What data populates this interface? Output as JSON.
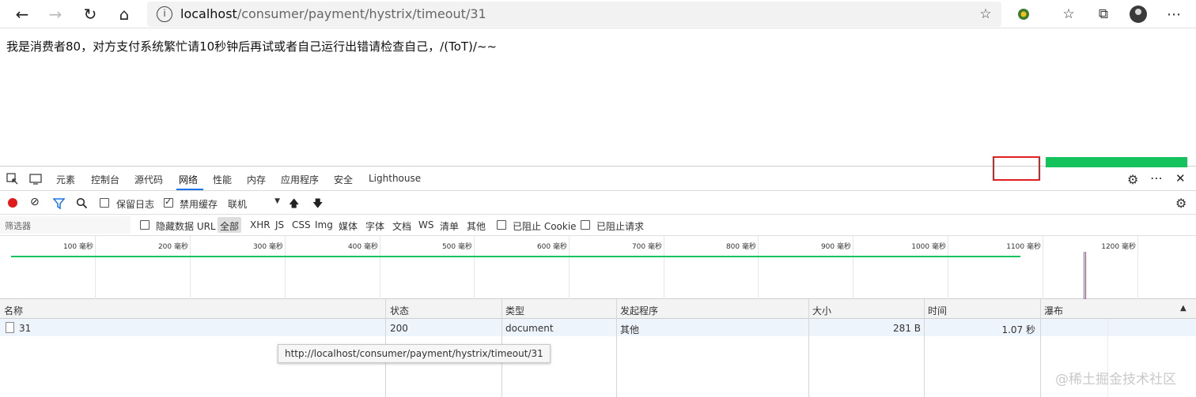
{
  "browser": {
    "url_host": "localhost",
    "url_path": "/consumer/payment/hystrix/timeout/31"
  },
  "page": {
    "message": "我是消费者80，对方支付系统繁忙请10秒钟后再试或者自己运行出错请检查自己，/(ToT)/~~"
  },
  "devtools": {
    "tabs": [
      "元素",
      "控制台",
      "源代码",
      "网络",
      "性能",
      "内存",
      "应用程序",
      "安全",
      "Lighthouse"
    ],
    "active_tab": "网络",
    "toolbar": {
      "preserve_log": "保留日志",
      "disable_cache": "禁用缓存",
      "throttle": "联机"
    },
    "filter": {
      "placeholder": "筛选器",
      "hide_data_urls": "隐藏数据 URL",
      "types": [
        "全部",
        "XHR",
        "JS",
        "CSS",
        "Img",
        "媒体",
        "字体",
        "文档",
        "WS",
        "清单",
        "其他"
      ],
      "blocked_cookies": "已阻止 Cookie",
      "blocked_requests": "已阻止请求"
    },
    "overview": {
      "ticks": [
        "100 毫秒",
        "200 毫秒",
        "300 毫秒",
        "400 毫秒",
        "500 毫秒",
        "600 毫秒",
        "700 毫秒",
        "800 毫秒",
        "900 毫秒",
        "1000 毫秒",
        "1100 毫秒",
        "1200 毫秒"
      ]
    },
    "table": {
      "headers": {
        "name": "名称",
        "status": "状态",
        "type": "类型",
        "initiator": "发起程序",
        "size": "大小",
        "time": "时间",
        "waterfall": "瀑布"
      },
      "rows": [
        {
          "name": "31",
          "status": "200",
          "type": "document",
          "initiator": "其他",
          "size": "281 B",
          "time": "1.07 秒"
        }
      ]
    },
    "tooltip": "http://localhost/consumer/payment/hystrix/timeout/31"
  },
  "watermark": "@稀土掘金技术社区",
  "colors": {
    "accent": "#1a73e8",
    "waterfall": "#14c35b",
    "highlight": "#e02020",
    "record": "#e01a1a"
  }
}
